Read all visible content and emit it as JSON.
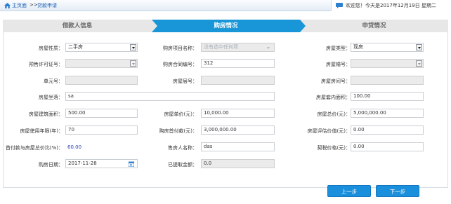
{
  "breadcrumb": {
    "home": "主页面",
    "separator": ">>",
    "current": "贷款申请"
  },
  "welcome": "欢迎您！今天是2017年12月19日 星期二",
  "steps": [
    "借款人信息",
    "购房情况",
    "申贷情况"
  ],
  "form": {
    "property_nature": {
      "label": "房屋性质：",
      "value": "二手房"
    },
    "project_name": {
      "label": "购房项目名称：",
      "placeholder": "没有选中任何项"
    },
    "property_type": {
      "label": "房屋类型：",
      "value": "现房"
    },
    "presale_permit": {
      "label": "预售许可证号：",
      "value": ""
    },
    "contract_no": {
      "label": "购房合同编号：",
      "value": "312"
    },
    "building_no": {
      "label": "房屋幢号：",
      "value": ""
    },
    "unit_no": {
      "label": "单元号：",
      "value": ""
    },
    "floor_no": {
      "label": "房屋层号：",
      "value": ""
    },
    "room_no": {
      "label": "房屋房间号：",
      "value": ""
    },
    "address": {
      "label": "房屋坐落：",
      "value": "sa"
    },
    "inner_area": {
      "label": "房屋套内面积：",
      "value": "100.00"
    },
    "building_area": {
      "label": "房屋建筑面积：",
      "value": "500.00"
    },
    "unit_price": {
      "label": "房屋单价(元)：",
      "value": "10,000.00"
    },
    "total_price": {
      "label": "房屋总价(元)：",
      "value": "5,000,000.00"
    },
    "use_years": {
      "label": "房屋使用年限(年)：",
      "value": "70"
    },
    "down_payment": {
      "label": "购房首付款(元)：",
      "value": "3,000,000.00"
    },
    "appraisal_value": {
      "label": "房屋评估价值(元)：",
      "value": "0.00"
    },
    "down_ratio": {
      "label": "首付款与房屋总价比(%)：",
      "value": "60.00"
    },
    "seller_name": {
      "label": "售房人名称：",
      "value": "das"
    },
    "deed_price": {
      "label": "契税价格(元)：",
      "value": "0.00"
    },
    "purchase_date": {
      "label": "购房日期：",
      "value": "2017-11-28"
    },
    "withdrawn_amount": {
      "label": "已提取金额：",
      "value": "0.0"
    }
  },
  "buttons": {
    "prev": "上一步",
    "next": "下一步"
  },
  "colors": {
    "active_step": "#1996d7",
    "button": "#1a8fdb",
    "link": "#1a62b6"
  }
}
